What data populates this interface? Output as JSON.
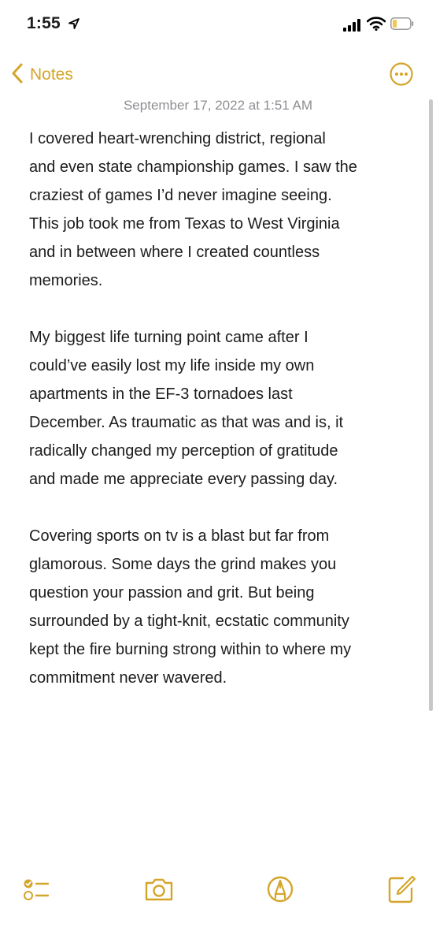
{
  "status_bar": {
    "time": "1:55",
    "icons": [
      "location-arrow-icon",
      "signal-icon",
      "wifi-icon",
      "battery-icon"
    ]
  },
  "nav": {
    "back_label": "Notes",
    "back_icon": "chevron-left-icon",
    "more_icon": "ellipsis-circle-icon"
  },
  "note": {
    "date": "September 17, 2022 at 1:51 AM",
    "paragraphs": [
      [
        "I covered heart-wrenching district, regional",
        "and even state championship games. I saw the",
        "craziest of games I’d never imagine seeing.",
        "This job took me from Texas to West Virginia",
        "and in between where I created countless",
        "memories."
      ],
      [
        "My biggest life turning point came after I",
        "could’ve easily lost my life inside my own",
        "apartments in the EF-3 tornadoes last",
        "December. As traumatic as that was and is, it",
        "radically changed my perception of gratitude",
        "and made me appreciate every passing day."
      ],
      [
        "Covering sports on tv is a blast but far from",
        "glamorous. Some days the grind makes you",
        "question your passion and grit. But being",
        "surrounded by a tight-knit, ecstatic community",
        "kept the fire burning strong within to where my",
        "commitment never wavered."
      ]
    ]
  },
  "toolbar": {
    "icons": [
      "checklist-icon",
      "camera-icon",
      "markup-pen-icon",
      "compose-icon"
    ]
  },
  "colors": {
    "accent": "#d4a52b",
    "text": "#1c1c1e",
    "secondary_text": "#8e8e93"
  }
}
